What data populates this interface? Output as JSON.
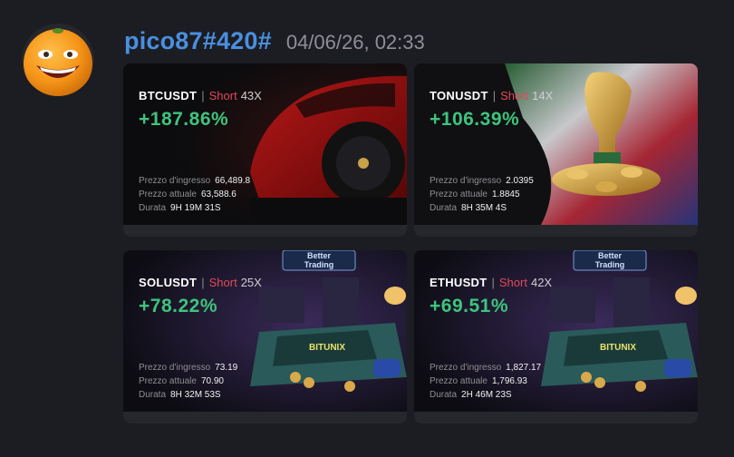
{
  "message": {
    "username": "pico87#420#",
    "timestamp": "04/06/26, 02:33"
  },
  "cards": [
    {
      "pair": "BTCUSDT",
      "side": "Short",
      "leverage": "43X",
      "pnl": "+187.86%",
      "entry_label": "Prezzo d'ingresso",
      "entry_value": "66,489.8",
      "current_label": "Prezzo attuale",
      "current_value": "63,588.6",
      "duration_label": "Durata",
      "duration_value": "9H 19M 31S",
      "art": "red-sports-car"
    },
    {
      "pair": "TONUSDT",
      "side": "Short",
      "leverage": "14X",
      "pnl": "+106.39%",
      "entry_label": "Prezzo d'ingresso",
      "entry_value": "2.0395",
      "current_label": "Prezzo attuale",
      "current_value": "1.8845",
      "duration_label": "Durata",
      "duration_value": "8H 35M 4S",
      "art": "trophy-with-coins"
    },
    {
      "pair": "SOLUSDT",
      "side": "Short",
      "leverage": "25X",
      "pnl": "+78.22%",
      "entry_label": "Prezzo d'ingresso",
      "entry_value": "73.19",
      "current_label": "Prezzo attuale",
      "current_value": "70.90",
      "duration_label": "Durata",
      "duration_value": "8H 32M 53S",
      "art": "better-trading-board",
      "art_sign": "Better Trading",
      "art_board": "BITUNIX"
    },
    {
      "pair": "ETHUSDT",
      "side": "Short",
      "leverage": "42X",
      "pnl": "+69.51%",
      "entry_label": "Prezzo d'ingresso",
      "entry_value": "1,827.17",
      "current_label": "Prezzo attuale",
      "current_value": "1,796.93",
      "duration_label": "Durata",
      "duration_value": "2H 46M 23S",
      "art": "better-trading-board",
      "art_sign": "Better Trading",
      "art_board": "BITUNIX"
    }
  ],
  "colors": {
    "username": "#4a8fe0",
    "profit": "#3ec47d",
    "short": "#e0495a",
    "background": "#1c1d22"
  }
}
